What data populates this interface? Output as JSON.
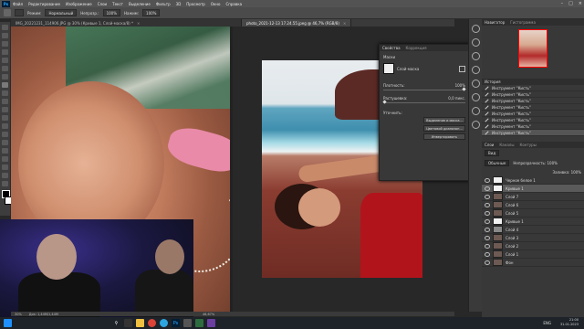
{
  "menubar": {
    "logo": "Ps",
    "items": [
      "Файл",
      "Редактирование",
      "Изображение",
      "Слои",
      "Текст",
      "Выделение",
      "Фильтр",
      "3D",
      "Просмотр",
      "Окно",
      "Справка"
    ]
  },
  "options": {
    "mode_label": "Режим:",
    "mode_value": "Нормальный",
    "opacity_label": "Непрозр.:",
    "opacity_value": "100%",
    "flow_label": "Нажим:",
    "flow_value": "100%"
  },
  "tabs": [
    {
      "label": "IMG_20221231_114906.JPG @ 30% (Кривые 1, Слой-маска/8) *"
    },
    {
      "label": "photo_2021-12-13 17.24.55.jpeg @ 46,7% (RGB/8)"
    }
  ],
  "status": {
    "zoom1": "30%",
    "doc1": "Док: 1,44M/1,44M",
    "zoom2": "46,67%"
  },
  "properties": {
    "tab1": "Свойства",
    "tab2": "Коррекция",
    "section": "Маски",
    "mask_name": "Слой-маска",
    "density_label": "Плотность:",
    "density_value": "100%",
    "feather_label": "Растушевка:",
    "feather_value": "0,0 пикс.",
    "refine_label": "Уточнить:",
    "btn_select_mask": "Выделение и маска...",
    "btn_color_range": "Цветовой диапазон...",
    "btn_invert": "Инвертировать"
  },
  "navigator": {
    "tab1": "Навигатор",
    "tab2": "Гистограмма"
  },
  "history": {
    "title": "История",
    "items": [
      "Инструмент \"Кисть\"",
      "Инструмент \"Кисть\"",
      "Инструмент \"Кисть\"",
      "Инструмент \"Кисть\"",
      "Инструмент \"Кисть\"",
      "Инструмент \"Кисть\"",
      "Инструмент \"Кисть\"",
      "Инструмент \"Кисть\""
    ]
  },
  "layers": {
    "tab1": "Слои",
    "tab2": "Каналы",
    "tab3": "Контуры",
    "kind": "Вид",
    "blend": "Обычные",
    "opacity": "Непрозрачность: 100%",
    "fill": "Заливка: 100%",
    "items": [
      {
        "name": "Черное белое 1",
        "thumb": "white"
      },
      {
        "name": "Кривые 1",
        "thumb": "white"
      },
      {
        "name": "Слой 7",
        "thumb": "photo"
      },
      {
        "name": "Слой 6",
        "thumb": "photo"
      },
      {
        "name": "Слой 5",
        "thumb": "photo"
      },
      {
        "name": "Кривые 1",
        "thumb": "white"
      },
      {
        "name": "Слой 4",
        "thumb": "gray"
      },
      {
        "name": "Слой 3",
        "thumb": "photo"
      },
      {
        "name": "Слой 2",
        "thumb": "photo"
      },
      {
        "name": "Слой 1",
        "thumb": "photo"
      },
      {
        "name": "Фон",
        "thumb": "photo"
      }
    ]
  },
  "taskbar": {
    "search": "",
    "lang": "ENG",
    "time": "21:00",
    "date": "31.01.2023"
  }
}
